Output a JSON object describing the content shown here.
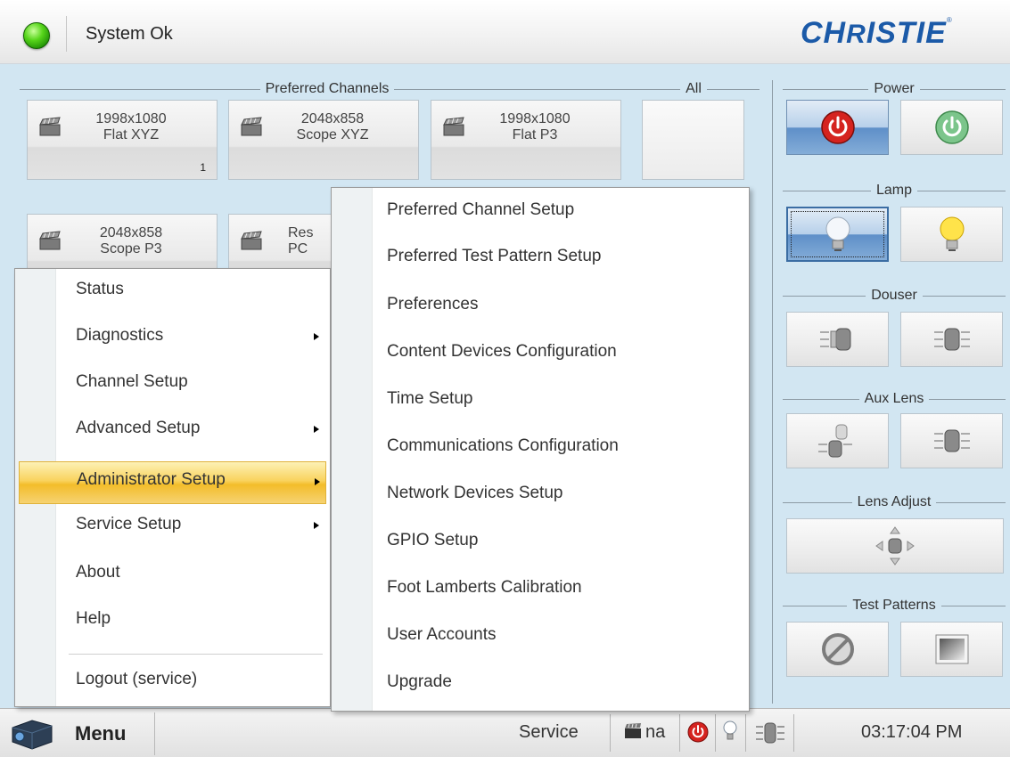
{
  "header": {
    "status_text": "System Ok",
    "status_color": "#3bbf12",
    "brand": "CHRISTIE",
    "brand_color": "#1b5aa8"
  },
  "preferred_channels": {
    "title": "Preferred Channels",
    "tiles": [
      {
        "line1": "1998x1080",
        "line2": "Flat XYZ",
        "number": "1"
      },
      {
        "line1": "2048x858",
        "line2": "Scope XYZ",
        "number": ""
      },
      {
        "line1": "1998x1080",
        "line2": "Flat P3",
        "number": ""
      },
      {
        "line1": "2048x858",
        "line2": "Scope P3",
        "number": ""
      },
      {
        "line1": "Res",
        "line2": "PC",
        "number": ""
      }
    ]
  },
  "all_channels": {
    "title": "All"
  },
  "controls": {
    "power": "Power",
    "lamp": "Lamp",
    "douser": "Douser",
    "aux_lens": "Aux Lens",
    "lens_adjust": "Lens Adjust",
    "test_patterns": "Test Patterns"
  },
  "main_menu": {
    "items": [
      {
        "label": "Status",
        "has_submenu": false
      },
      {
        "label": "Diagnostics",
        "has_submenu": true
      },
      {
        "label": "Channel Setup",
        "has_submenu": false
      },
      {
        "label": "Advanced Setup",
        "has_submenu": true
      },
      {
        "label": "Administrator Setup",
        "has_submenu": true,
        "highlighted": true
      },
      {
        "label": "Service Setup",
        "has_submenu": true
      },
      {
        "label": "About",
        "has_submenu": false
      },
      {
        "label": "Help",
        "has_submenu": false
      },
      {
        "label": "Logout (service)",
        "has_submenu": false
      }
    ]
  },
  "sub_menu": {
    "items": [
      {
        "label": "Preferred Channel Setup"
      },
      {
        "label": "Preferred Test Pattern Setup"
      },
      {
        "label": "Preferences"
      },
      {
        "label": "Content Devices Configuration"
      },
      {
        "label": "Time Setup"
      },
      {
        "label": "Communications Configuration"
      },
      {
        "label": "Network Devices Setup"
      },
      {
        "label": "GPIO Setup"
      },
      {
        "label": "Foot Lamberts Calibration"
      },
      {
        "label": "User Accounts"
      },
      {
        "label": "Upgrade"
      }
    ]
  },
  "bottom_bar": {
    "menu_label": "Menu",
    "role": "Service",
    "channel_status": "na",
    "time": "03:17:04 PM"
  },
  "icons": {
    "status": "green-led-icon",
    "menu": "projector-icon",
    "power_off": "power-off-icon",
    "power_on": "power-on-icon",
    "lamp_off": "lamp-off-icon",
    "lamp_on": "lamp-on-icon",
    "douser_closed": "douser-closed-icon",
    "douser_open": "douser-open-icon",
    "aux_lens_in": "aux-lens-in-icon",
    "aux_lens_out": "aux-lens-out-icon",
    "lens_adjust": "lens-adjust-icon",
    "test_pattern_off": "test-pattern-off-icon",
    "test_pattern_on": "test-pattern-on-icon"
  }
}
